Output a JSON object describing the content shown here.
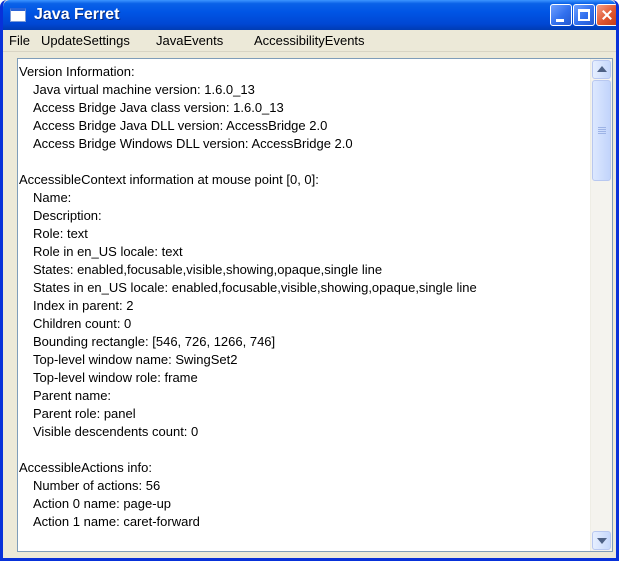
{
  "window": {
    "title": "Java Ferret"
  },
  "menu": [
    "File",
    "UpdateSettings",
    "JavaEvents",
    "AccessibilityEvents"
  ],
  "content": {
    "version": {
      "header": "Version Information:",
      "lines": [
        "Java virtual machine version: 1.6.0_13",
        "Access Bridge Java class version: 1.6.0_13",
        "Access Bridge Java DLL version: AccessBridge 2.0",
        "Access Bridge Windows DLL version: AccessBridge 2.0"
      ]
    },
    "context": {
      "header": "AccessibleContext information at mouse point [0, 0]:",
      "lines": [
        "Name:",
        "Description:",
        "Role:  text",
        "Role in en_US locale:  text",
        "States:  enabled,focusable,visible,showing,opaque,single line",
        "States in en_US locale:  enabled,focusable,visible,showing,opaque,single line",
        "Index in parent:  2",
        "Children count:  0",
        "Bounding rectangle:  [546, 726, 1266, 746]",
        "Top-level window name:  SwingSet2",
        "Top-level window role:  frame",
        "Parent name:",
        "Parent role:  panel",
        "Visible descendents count:  0"
      ]
    },
    "actions": {
      "header": "AccessibleActions info:",
      "lines": [
        "Number of actions:  56",
        "Action 0 name: page-up",
        "Action 1 name: caret-forward"
      ]
    }
  },
  "icons": {
    "app": "window-icon",
    "minimize": "minimize-icon",
    "maximize": "maximize-icon",
    "close": "close-icon",
    "scroll_up": "scroll-up-icon",
    "scroll_down": "scroll-down-icon"
  },
  "colors": {
    "titlebar": "#0055e5",
    "close_button": "#e0562f",
    "window_bg": "#ece9d8",
    "border": "#7f9db9"
  }
}
